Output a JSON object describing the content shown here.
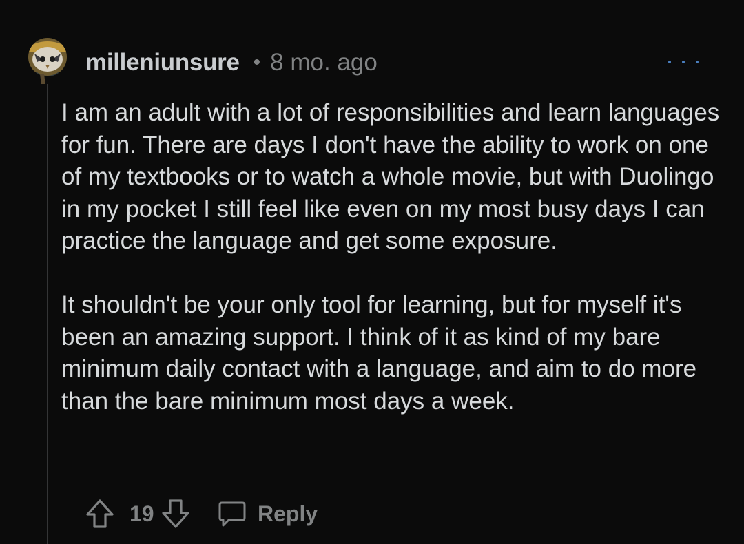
{
  "comment": {
    "username": "milleniunsure",
    "separator": "•",
    "time_ago": "8 mo. ago",
    "more_icon": "ellipsis-icon",
    "paragraphs": [
      "I am an adult with a lot of responsibilities and learn languages for fun. There are days I don't have the ability to work on one of my textbooks or to watch a whole movie, but with Duolingo in my pocket I still feel like even on my most busy days I can practice the language and get some exposure.",
      "It shouldn't be your only tool for learning, but for myself it's been an amazing support. I think of it as kind of my bare minimum daily contact with a language, and aim to do more than the bare minimum most days a week."
    ],
    "score": "19",
    "reply_label": "Reply"
  },
  "icons": {
    "upvote": "upvote-arrow-icon",
    "downvote": "downvote-arrow-icon",
    "reply": "speech-bubble-icon"
  },
  "colors": {
    "background": "#0b0b0b",
    "text": "#d7dadc",
    "muted": "#818384",
    "more_dots": "#4a7fbf"
  }
}
